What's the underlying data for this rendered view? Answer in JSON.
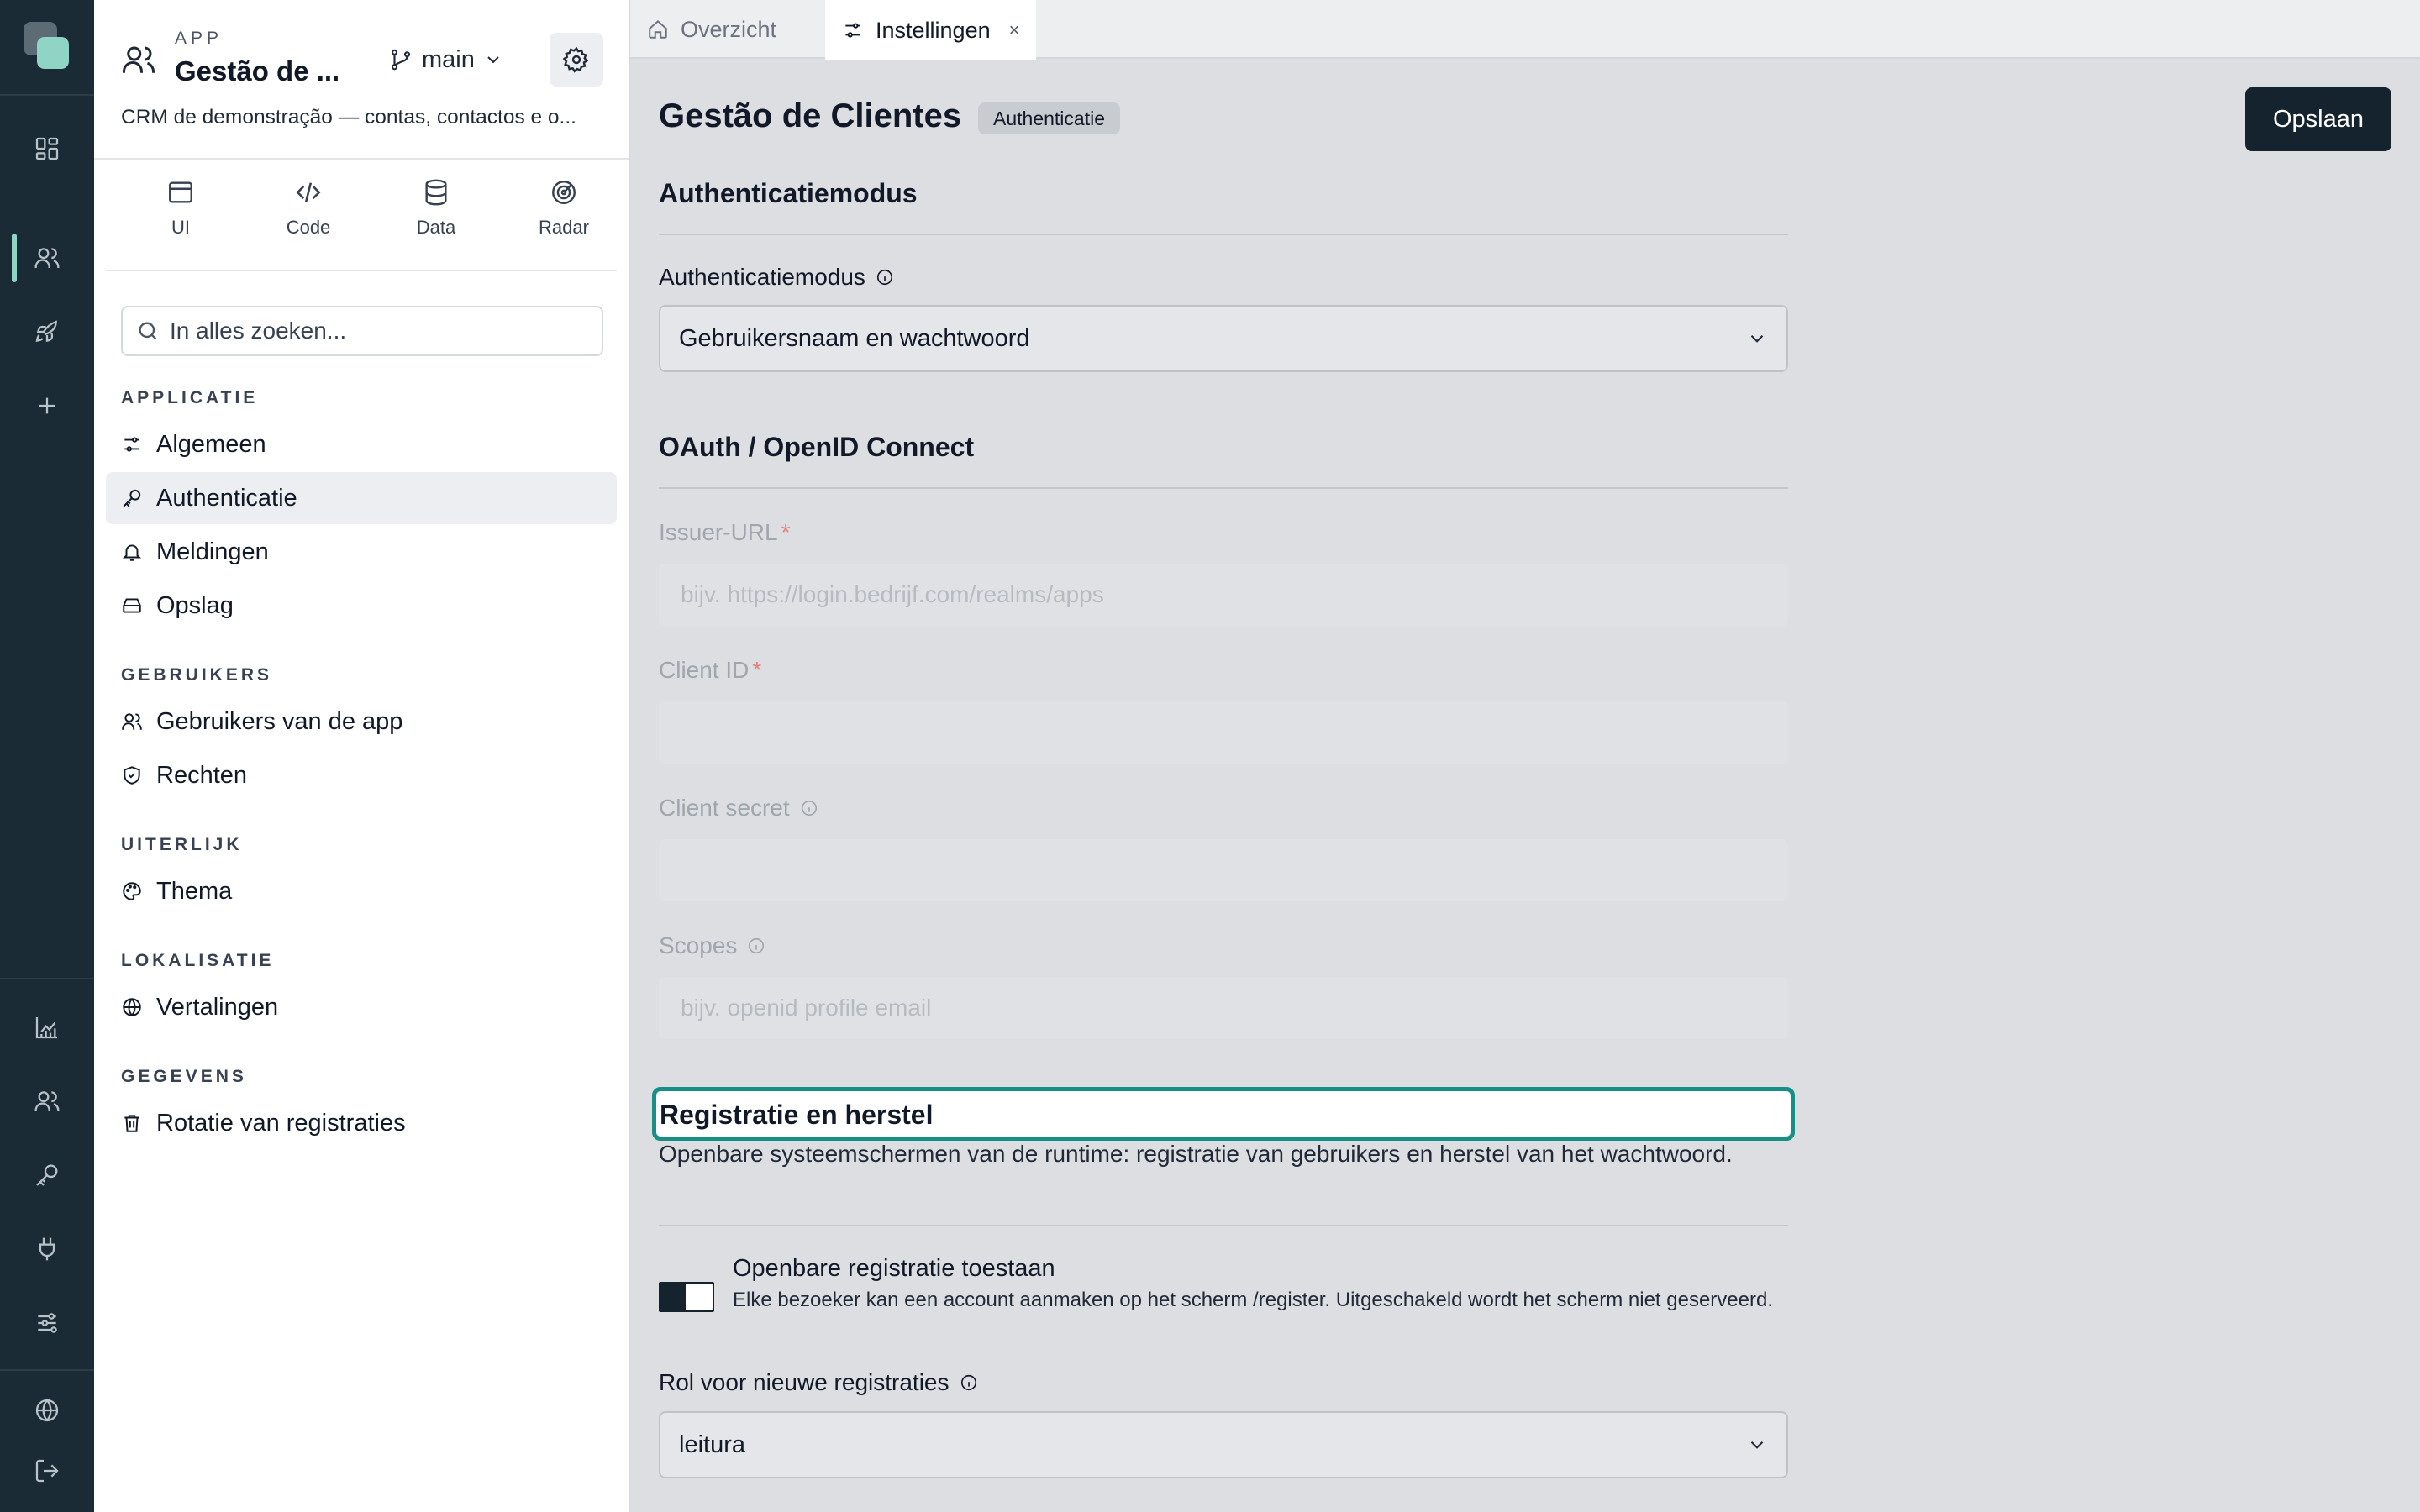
{
  "rail": {
    "items": [
      "dashboard-icon",
      "users-icon",
      "rocket-icon",
      "plus-icon",
      "chart-icon",
      "team-icon",
      "key-icon",
      "plug-icon",
      "sliders-icon",
      "globe-icon",
      "logout-icon"
    ]
  },
  "app": {
    "kicker": "APP",
    "title": "Gestão de ...",
    "branch": "main",
    "description": "CRM de demonstração — contas, contactos e o..."
  },
  "tools": [
    {
      "label": "UI",
      "icon": "window-icon"
    },
    {
      "label": "Code",
      "icon": "code-icon"
    },
    {
      "label": "Data",
      "icon": "database-icon"
    },
    {
      "label": "Radar",
      "icon": "radar-icon"
    }
  ],
  "search": {
    "placeholder": "In alles zoeken..."
  },
  "nav": {
    "sections": [
      {
        "title": "APPLICATIE",
        "items": [
          {
            "label": "Algemeen",
            "icon": "sliders-icon"
          },
          {
            "label": "Authenticatie",
            "icon": "key-icon",
            "active": true
          },
          {
            "label": "Meldingen",
            "icon": "bell-icon"
          },
          {
            "label": "Opslag",
            "icon": "storage-icon"
          }
        ]
      },
      {
        "title": "GEBRUIKERS",
        "items": [
          {
            "label": "Gebruikers van de app",
            "icon": "users-icon"
          },
          {
            "label": "Rechten",
            "icon": "shield-icon"
          }
        ]
      },
      {
        "title": "UITERLIJK",
        "items": [
          {
            "label": "Thema",
            "icon": "palette-icon"
          }
        ]
      },
      {
        "title": "LOKALISATIE",
        "items": [
          {
            "label": "Vertalingen",
            "icon": "globe-icon"
          }
        ]
      },
      {
        "title": "GEGEVENS",
        "items": [
          {
            "label": "Rotatie van registraties",
            "icon": "trash-icon"
          }
        ]
      }
    ]
  },
  "tabs": [
    {
      "label": "Overzicht",
      "icon": "home-icon"
    },
    {
      "label": "Instellingen",
      "icon": "sliders-icon",
      "close": "×"
    }
  ],
  "page": {
    "title": "Gestão de Clientes",
    "badge": "Authenticatie",
    "save_label": "Opslaan"
  },
  "auth_mode": {
    "section_title": "Authenticatiemodus",
    "label": "Authenticatiemodus",
    "value": "Gebruikersnaam en wachtwoord"
  },
  "oauth": {
    "section_title": "OAuth / OpenID Connect",
    "issuer_label": "Issuer-URL",
    "issuer_placeholder": "bijv. https://login.bedrijf.com/realms/apps",
    "client_id_label": "Client ID",
    "client_secret_label": "Client secret",
    "scopes_label": "Scopes",
    "scopes_placeholder": "bijv. openid profile email",
    "required_mark": "*"
  },
  "registration": {
    "section_title": "Registratie en herstel",
    "description": "Openbare systeemschermen van de runtime: registratie van gebruikers en herstel van het wachtwoord.",
    "toggle_title": "Openbare registratie toestaan",
    "toggle_desc": "Elke bezoeker kan een account aanmaken op het scherm /register. Uitgeschakeld wordt het scherm niet geserveerd.",
    "toggle_on": true,
    "role_label": "Rol voor nieuwe registraties",
    "role_value": "leitura"
  },
  "colors": {
    "rail_bg": "#1b2b36",
    "accent": "#8fd4c5",
    "focus": "#168f86",
    "primary_button": "#15232e"
  }
}
